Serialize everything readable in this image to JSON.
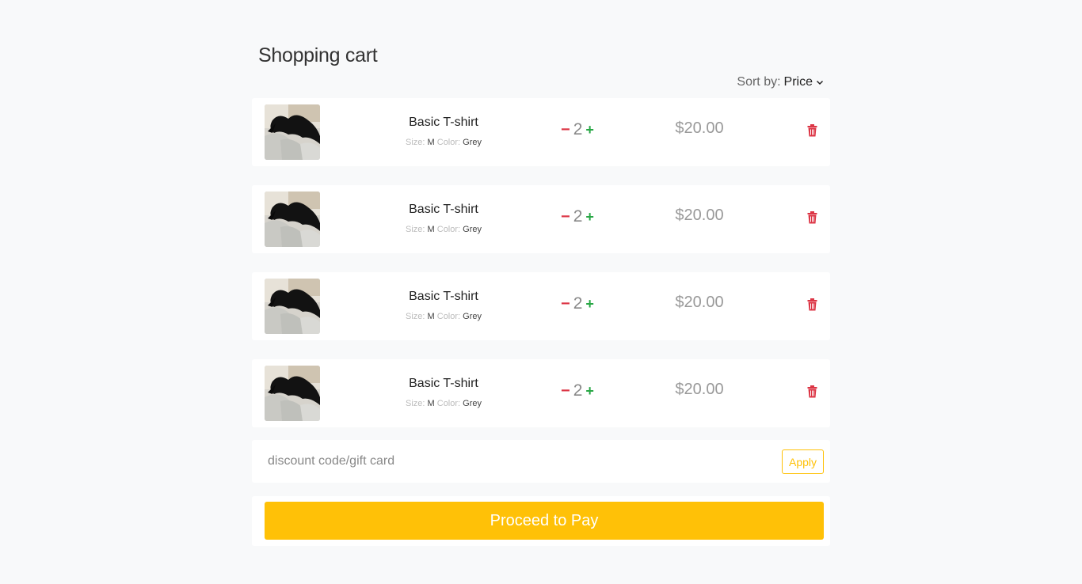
{
  "page": {
    "title": "Shopping cart"
  },
  "sort": {
    "label": "Sort by:",
    "value": "Price"
  },
  "items": [
    {
      "name": "Basic T-shirt",
      "size_label": "Size:",
      "size": "M",
      "color_label": "Color:",
      "color": "Grey",
      "quantity": "2",
      "price": "$20.00"
    },
    {
      "name": "Basic T-shirt",
      "size_label": "Size:",
      "size": "M",
      "color_label": "Color:",
      "color": "Grey",
      "quantity": "2",
      "price": "$20.00"
    },
    {
      "name": "Basic T-shirt",
      "size_label": "Size:",
      "size": "M",
      "color_label": "Color:",
      "color": "Grey",
      "quantity": "2",
      "price": "$20.00"
    },
    {
      "name": "Basic T-shirt",
      "size_label": "Size:",
      "size": "M",
      "color_label": "Color:",
      "color": "Grey",
      "quantity": "2",
      "price": "$20.00"
    }
  ],
  "discount": {
    "placeholder": "discount code/gift card",
    "apply_label": "Apply"
  },
  "checkout": {
    "pay_label": "Proceed to Pay"
  },
  "colors": {
    "accent": "#ffc107",
    "decrease": "#dc3545",
    "increase": "#28a745",
    "delete": "#dc3545"
  },
  "icons": {
    "sort": "chevron-down-icon",
    "decrease": "minus-icon",
    "increase": "plus-icon",
    "remove": "trash-icon"
  }
}
